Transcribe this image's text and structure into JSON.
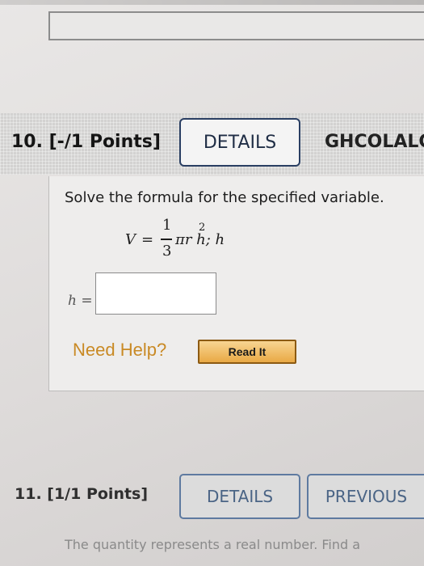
{
  "question10": {
    "number_label": "10. [-/1 Points]",
    "details_label": "DETAILS",
    "code_label": "GHCOLALG",
    "instruction": "Solve the formula for the specified variable.",
    "formula": {
      "lhs": "V",
      "equals": "=",
      "numerator": "1",
      "denominator": "3",
      "rest": "πr h; h",
      "exponent": "2"
    },
    "answer_label": "h =",
    "answer_value": "",
    "need_help": "Need Help?",
    "read_it": "Read It"
  },
  "question11": {
    "number_label": "11. [1/1 Points]",
    "details_label": "DETAILS",
    "previous_label": "PREVIOUS",
    "text": "The quantity represents a real number. Find a"
  },
  "colors": {
    "need_help": "#c98a25",
    "read_it_fill": "#e9a945",
    "details_border": "#2a3f63"
  }
}
